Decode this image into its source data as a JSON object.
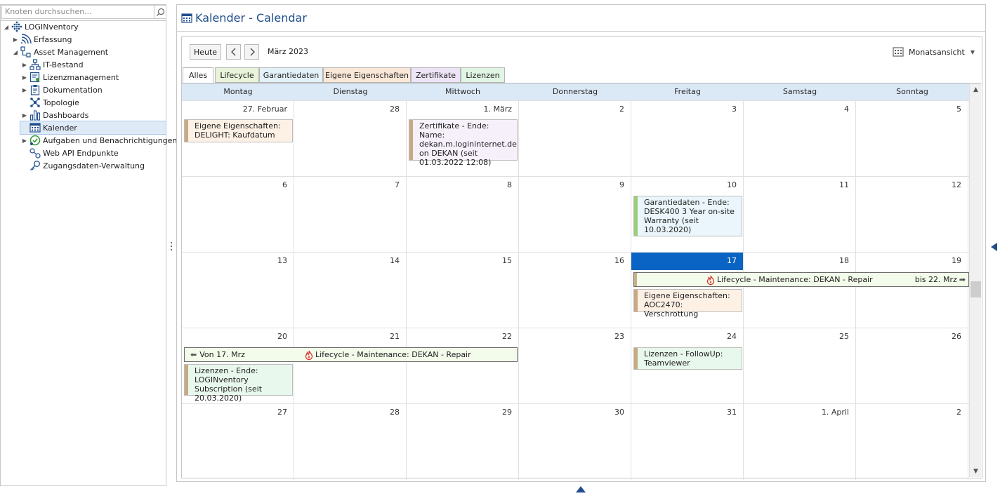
{
  "search": {
    "placeholder": "Knoten durchsuchen..."
  },
  "tree": {
    "items": [
      {
        "label": "LOGINventory",
        "icon": "grid-dots-icon"
      },
      {
        "label": "Erfassung",
        "icon": "wifi-scan-icon"
      },
      {
        "label": "Asset Management",
        "icon": "hierarchy-icon"
      },
      {
        "label": "IT-Bestand",
        "icon": "network-icon"
      },
      {
        "label": "Lizenzmanagement",
        "icon": "license-icon"
      },
      {
        "label": "Dokumentation",
        "icon": "clipboard-icon"
      },
      {
        "label": "Topologie",
        "icon": "topology-icon"
      },
      {
        "label": "Dashboards",
        "icon": "bar-chart-icon"
      },
      {
        "label": "Kalender",
        "icon": "calendar-icon"
      },
      {
        "label": "Aufgaben und Benachrichtigungen",
        "icon": "task-icon"
      },
      {
        "label": "Web API Endpunkte",
        "icon": "webapi-icon"
      },
      {
        "label": "Zugangsdaten-Verwaltung",
        "icon": "key-icon"
      }
    ]
  },
  "main": {
    "title": "Kalender - Calendar"
  },
  "toolbar": {
    "today_label": "Heute",
    "month_label": "März 2023",
    "view_label": "Monatsansicht"
  },
  "tabs": [
    {
      "label": "Alles",
      "color": "#ffffff"
    },
    {
      "label": "Lifecycle",
      "color": "#e8f3da"
    },
    {
      "label": "Garantiedaten",
      "color": "#e3f1f8"
    },
    {
      "label": "Eigene Eigenschaften",
      "color": "#fae7d7"
    },
    {
      "label": "Zertifikate",
      "color": "#ede4f6"
    },
    {
      "label": "Lizenzen",
      "color": "#e1f5e4"
    }
  ],
  "days": [
    "Montag",
    "Dienstag",
    "Mittwoch",
    "Donnerstag",
    "Freitag",
    "Samstag",
    "Sonntag"
  ],
  "weeks": [
    [
      "27. Februar",
      "28",
      "1. März",
      "2",
      "3",
      "4",
      "5"
    ],
    [
      "6",
      "7",
      "8",
      "9",
      "10",
      "11",
      "12"
    ],
    [
      "13",
      "14",
      "15",
      "16",
      "17",
      "18",
      "19"
    ],
    [
      "20",
      "21",
      "22",
      "23",
      "24",
      "25",
      "26"
    ],
    [
      "27",
      "28",
      "29",
      "30",
      "31",
      "1. April",
      "2"
    ]
  ],
  "today": "17",
  "appointments": {
    "a1": {
      "text": "Eigene Eigenschaften: DELIGHT: Kaufdatum"
    },
    "a2": {
      "text": "Zertifikate - Ende: Name: dekan.m.logininternet.de on DEKAN (seit 01.03.2022 12:08)"
    },
    "a3": {
      "text": "Garantiedaten - Ende: DESK400 3 Year on-site Warranty (seit 10.03.2020)"
    },
    "a4": {
      "text": "Eigene Eigenschaften: AOC2470: Verschrottung"
    },
    "a5": {
      "text": "Lizenzen - Ende: LOGINventory Subscription (seit 20.03.2020)"
    },
    "a6": {
      "text": "Lizenzen - FollowUp: Teamviewer"
    },
    "s1": {
      "text": "Lifecycle - Maintenance: DEKAN - Repair",
      "until": "bis 22. Mrz"
    },
    "s2": {
      "text": "Lifecycle - Maintenance: DEKAN - Repair",
      "from": "Von 17. Mrz"
    }
  },
  "colors": {
    "accent": "#1f4e8c",
    "today": "#0a64c3",
    "header_band": "#dbe8f6",
    "eigene": "#fdf1e6",
    "zertifikate": "#f6f0fb",
    "garantie": "#eaf6fb",
    "lizenzen": "#e8f8ec",
    "lifecycle": "#f3fbea"
  }
}
